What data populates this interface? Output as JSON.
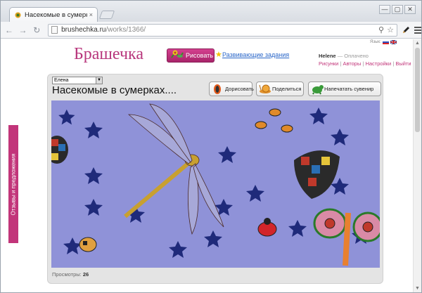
{
  "browser": {
    "tab_title": "Насекомые в сумерках.",
    "tab_close": "×",
    "window_buttons": [
      "—",
      "▢",
      "✕"
    ],
    "url_host": "brushechka.ru",
    "url_path": "/works/1366/"
  },
  "header": {
    "logo": "Брашечка",
    "draw_button": "Рисовать",
    "tasks_link": "Развивающие задания",
    "lang_label": "Язык:",
    "user_name": "Helene",
    "user_status": " — Оплачено",
    "menu": [
      "Рисунки",
      "Авторы",
      "Настройки",
      "Выйти"
    ],
    "menu_sep": " | "
  },
  "side_tab": "Отзывы и предложения",
  "work": {
    "author": "Елена",
    "title": "Насекомые в сумерках....",
    "buttons": {
      "finish": "Дорисовать",
      "share": "Поделиться",
      "print": "Напечатать сувенир"
    },
    "views_label": "Просмотры:",
    "views_count": "26"
  },
  "colors": {
    "brand": "#b8377d",
    "canvas": "#8f92d8",
    "link": "#2a67c9"
  }
}
